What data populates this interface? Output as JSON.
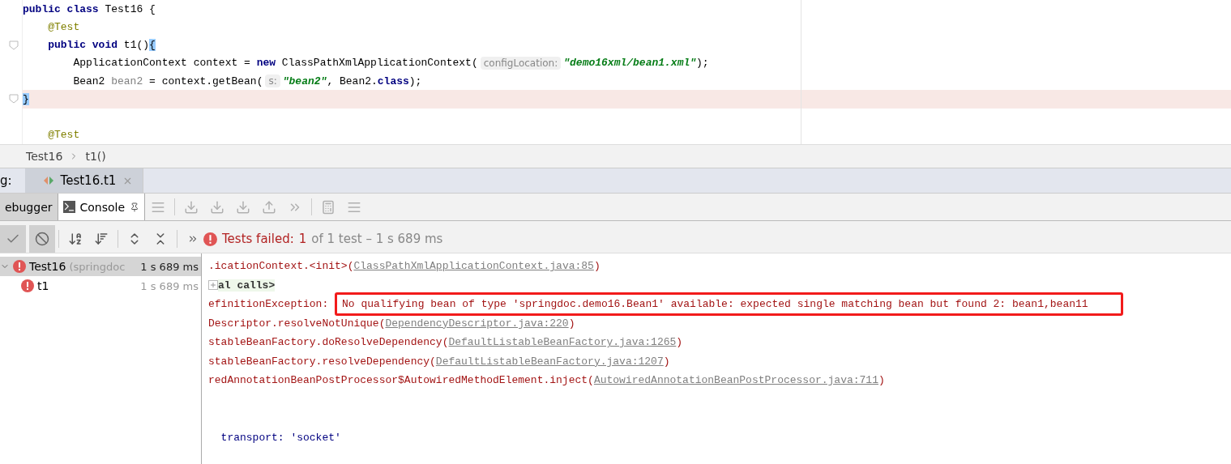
{
  "editor": {
    "lines": [
      {
        "highlighted": false,
        "fold": false,
        "tokens": [
          {
            "kind": "keyword",
            "text": "public class"
          },
          {
            "kind": "plain",
            "text": " Test16 {"
          }
        ]
      },
      {
        "highlighted": false,
        "fold": false,
        "tokens": [
          {
            "kind": "annotation",
            "text": "    @Test"
          }
        ]
      },
      {
        "highlighted": false,
        "fold": true,
        "tokens": [
          {
            "kind": "keyword",
            "text": "    public void"
          },
          {
            "kind": "plain",
            "text": " t1()"
          },
          {
            "kind": "brace",
            "text": "{"
          }
        ]
      },
      {
        "highlighted": false,
        "fold": false,
        "tokens": [
          {
            "kind": "plain",
            "text": "        ApplicationContext context = "
          },
          {
            "kind": "keyword",
            "text": "new"
          },
          {
            "kind": "plain",
            "text": " ClassPathXmlApplicationContext("
          },
          {
            "kind": "hint",
            "text": "configLocation:"
          },
          {
            "kind": "string",
            "text": "\"demo16xml/bean1.xml\""
          },
          {
            "kind": "plain",
            "text": ");"
          }
        ]
      },
      {
        "highlighted": false,
        "fold": false,
        "tokens": [
          {
            "kind": "plain",
            "text": "        Bean2 "
          },
          {
            "kind": "unused",
            "text": "bean2"
          },
          {
            "kind": "plain",
            "text": " = context.getBean("
          },
          {
            "kind": "hint",
            "text": "s:"
          },
          {
            "kind": "string",
            "text": "\"bean2\""
          },
          {
            "kind": "plain",
            "text": ", Bean2."
          },
          {
            "kind": "keyword",
            "text": "class"
          },
          {
            "kind": "plain",
            "text": ");"
          }
        ]
      },
      {
        "highlighted": true,
        "fold": true,
        "tokens": [
          {
            "kind": "brace",
            "text": "}"
          }
        ]
      },
      {
        "highlighted": false,
        "fold": false
      },
      {
        "highlighted": false,
        "fold": false,
        "tokens": [
          {
            "kind": "annotation",
            "text": "    @Test"
          }
        ]
      }
    ]
  },
  "breadcrumbs": [
    "Test16",
    "t1()"
  ],
  "run_bar": {
    "label": "g:",
    "tabs": [
      {
        "label": "Test16.t1",
        "selected": true
      }
    ]
  },
  "tool_tabs": [
    {
      "label": "ebugger",
      "selected": false
    },
    {
      "label": "Console",
      "selected": true
    }
  ],
  "status": {
    "label": "Tests failed:",
    "count": "1",
    "rest": "of 1 test – 1 s 689 ms"
  },
  "tree": [
    {
      "name": "Test16",
      "detail": "(springdoc",
      "time": "1 s 689 ms",
      "selected": true,
      "children": [
        {
          "name": "t1",
          "time": "1 s 689 ms",
          "selected": false
        }
      ]
    }
  ],
  "console": [
    [
      {
        "kind": "error",
        "text": ".icationContext.<init>("
      },
      {
        "kind": "link",
        "text": "ClassPathXmlApplicationContext.java:85"
      },
      {
        "kind": "error",
        "text": ")"
      }
    ],
    [
      {
        "kind": "fold",
        "text": "al calls>"
      }
    ],
    [
      {
        "kind": "error",
        "text": "efinitionException: "
      },
      {
        "kind": "boxed",
        "text": "No qualifying bean of type 'springdoc.demo16.Bean1' available: expected single matching bean but found 2: bean1,bean11"
      }
    ],
    [
      {
        "kind": "error",
        "text": "Descriptor.resolveNotUnique("
      },
      {
        "kind": "link",
        "text": "DependencyDescriptor.java:220"
      },
      {
        "kind": "error",
        "text": ")"
      }
    ],
    [
      {
        "kind": "error",
        "text": "stableBeanFactory.doResolveDependency("
      },
      {
        "kind": "link",
        "text": "DefaultListableBeanFactory.java:1265"
      },
      {
        "kind": "error",
        "text": ")"
      }
    ],
    [
      {
        "kind": "error",
        "text": "stableBeanFactory.resolveDependency("
      },
      {
        "kind": "link",
        "text": "DefaultListableBeanFactory.java:1207"
      },
      {
        "kind": "error",
        "text": ")"
      }
    ],
    [
      {
        "kind": "error",
        "text": "redAnnotationBeanPostProcessor$AutowiredMethodElement.inject("
      },
      {
        "kind": "link",
        "text": "AutowiredAnnotationBeanPostProcessor.java:711"
      },
      {
        "kind": "error",
        "text": ")"
      }
    ],
    [
      {
        "kind": "plain",
        "text": "  transport: 'socket'"
      }
    ]
  ]
}
